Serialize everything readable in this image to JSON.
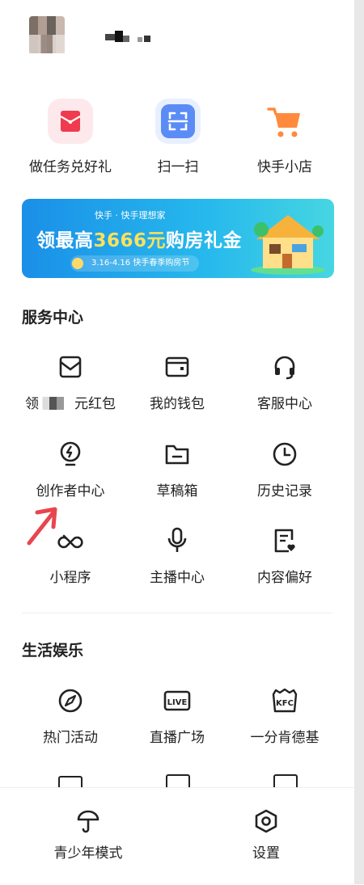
{
  "header": {
    "avatar_icon": "avatar-icon",
    "username_obscured": true
  },
  "quick_actions": [
    {
      "label": "做任务兑好礼",
      "icon": "red-envelope-icon",
      "color": "#f03a4e"
    },
    {
      "label": "扫一扫",
      "icon": "scan-icon",
      "color": "#5b8cf5"
    },
    {
      "label": "快手小店",
      "icon": "cart-icon",
      "color": "#ff8a3d"
    }
  ],
  "banner": {
    "brand": "快手 · 快手理想家",
    "headline_pre": "领最高",
    "headline_num": "3666元",
    "headline_post": "购房礼金",
    "date_text": "3.16-4.16  快手春季购房节"
  },
  "service_center": {
    "title": "服务中心",
    "items": [
      {
        "label_pre": "领",
        "label_post": "元红包",
        "icon": "red-packet-icon"
      },
      {
        "label": "我的钱包",
        "icon": "wallet-icon"
      },
      {
        "label": "客服中心",
        "icon": "headset-icon"
      },
      {
        "label": "创作者中心",
        "icon": "creator-bulb-icon"
      },
      {
        "label": "草稿箱",
        "icon": "folder-icon"
      },
      {
        "label": "历史记录",
        "icon": "clock-icon"
      },
      {
        "label": "小程序",
        "icon": "mini-program-icon"
      },
      {
        "label": "主播中心",
        "icon": "microphone-icon"
      },
      {
        "label": "内容偏好",
        "icon": "preference-doc-icon"
      }
    ]
  },
  "life_entertainment": {
    "title": "生活娱乐",
    "items": [
      {
        "label": "热门活动",
        "icon": "compass-icon"
      },
      {
        "label": "直播广场",
        "icon": "live-icon",
        "badge": "LIVE"
      },
      {
        "label": "一分肯德基",
        "icon": "kfc-icon",
        "badge": "KFC"
      }
    ]
  },
  "bottom_bar": {
    "items": [
      {
        "label": "青少年模式",
        "icon": "umbrella-icon"
      },
      {
        "label": "设置",
        "icon": "settings-hex-icon"
      }
    ]
  },
  "annotation": {
    "icon": "red-arrow-icon",
    "color": "#e8464e"
  }
}
